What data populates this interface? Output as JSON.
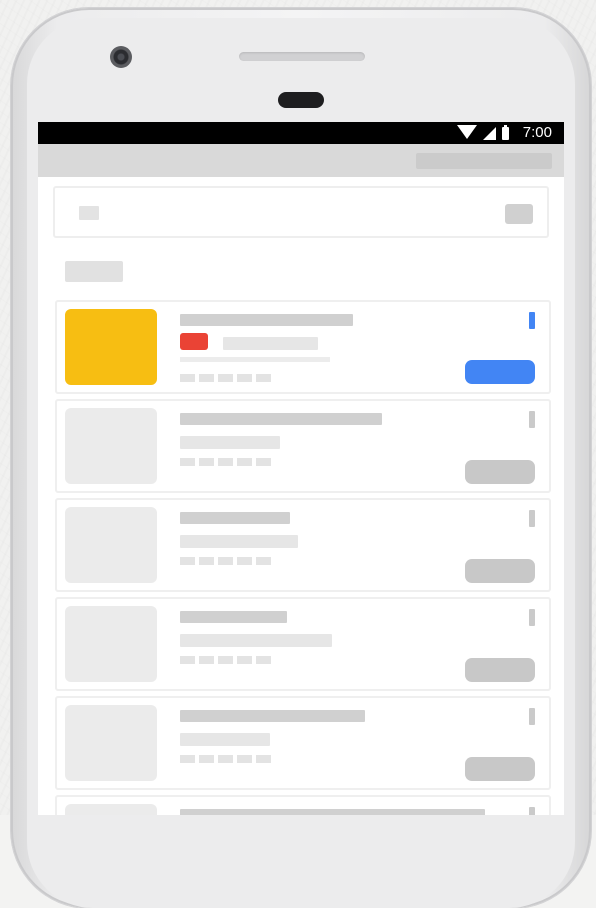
{
  "status_bar": {
    "time": "7:00",
    "icons": [
      "wifi-icon",
      "signal-icon",
      "battery-icon"
    ]
  },
  "colors": {
    "accent_blue": "#4285f4",
    "highlight_yellow": "#f7be12",
    "tag_red": "#ea4335",
    "placeholder_gray": "#d0d0d0"
  },
  "list": {
    "items": [
      {
        "state": "selected",
        "thumbnail_color": "#f7be12"
      },
      {
        "state": "placeholder"
      },
      {
        "state": "placeholder"
      },
      {
        "state": "placeholder"
      },
      {
        "state": "placeholder"
      },
      {
        "state": "placeholder"
      }
    ]
  }
}
